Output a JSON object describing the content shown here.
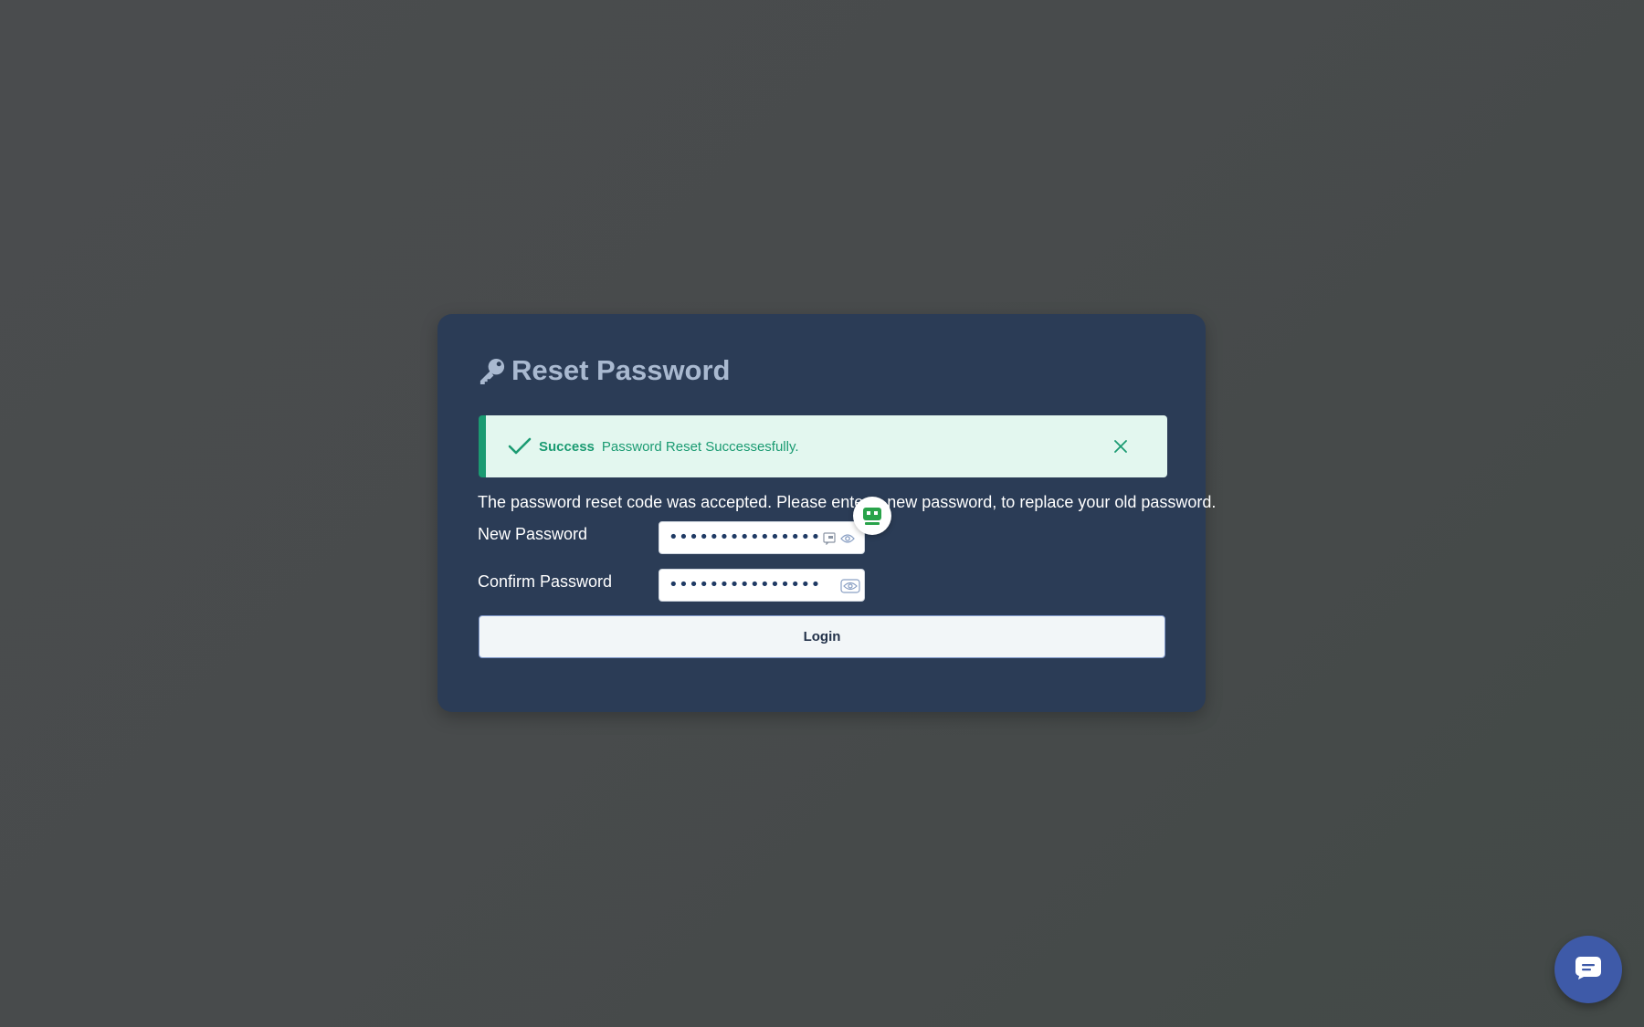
{
  "page": {
    "title": "Reset Password",
    "title_icon": "key-icon"
  },
  "alert": {
    "type": "success",
    "strong": "Success",
    "message": "Password Reset Successesfully.",
    "color": "#1b9b72",
    "background": "#e3f7ef"
  },
  "form": {
    "description": "The password reset code was accepted. Please enter a new password, to replace your old password.",
    "new_password": {
      "label": "New Password",
      "masked_value": "•••••••••••••••"
    },
    "confirm_password": {
      "label": "Confirm Password",
      "masked_value": "•••••••••••••••"
    },
    "submit_label": "Login"
  },
  "colors": {
    "card": "#2b3c56",
    "title": "#a9b9d0",
    "chat_button": "#3e5aa8",
    "helper_green": "#29a34a"
  }
}
